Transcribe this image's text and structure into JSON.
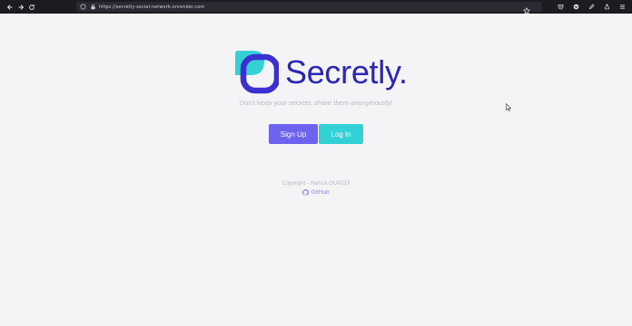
{
  "browser": {
    "url": "https://secretly-social-network.onrender.com",
    "icons": [
      "back-arrow-icon",
      "forward-arrow-icon",
      "reload-icon",
      "shield-icon",
      "lock-icon",
      "bookmark-star-icon",
      "pocket-icon",
      "extension-icon",
      "pen-icon",
      "share-icon",
      "menu-icon"
    ]
  },
  "brand": {
    "name": "Secretly.",
    "tagline": "Don't keep your secrets, share them anonymously!",
    "colors": {
      "primary": "#2b27b4",
      "accent": "#6c63f0",
      "teal": "#33d1d6"
    }
  },
  "actions": {
    "signup_label": "Sign Up",
    "login_label": "Log In"
  },
  "footer": {
    "copyright": "Copyright - Hamza OUADDI",
    "github_label": "GitHub"
  }
}
